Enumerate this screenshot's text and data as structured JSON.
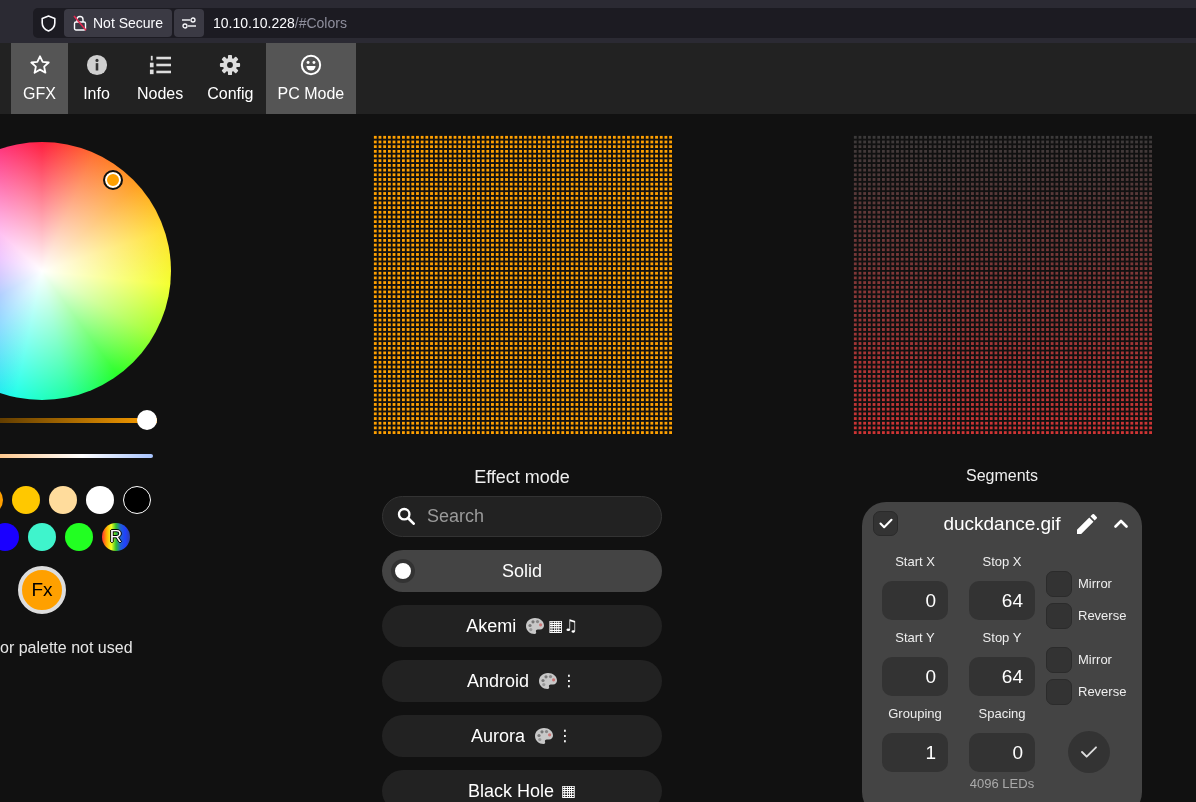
{
  "browser": {
    "security_label": "Not Secure",
    "url_host": "10.10.10.228",
    "url_path": "/#Colors"
  },
  "nav": {
    "tabs": [
      {
        "label": "GFX",
        "selected": true
      },
      {
        "label": "Info",
        "selected": false
      },
      {
        "label": "Nodes",
        "selected": false
      },
      {
        "label": "Config",
        "selected": false
      },
      {
        "label": "PC Mode",
        "selected": true
      }
    ]
  },
  "colors": {
    "brightness": {
      "level": 1
    },
    "swatch_rows": [
      [
        {
          "kind": "solid",
          "color": "#ffa000"
        },
        {
          "kind": "solid",
          "color": "#ffc800"
        },
        {
          "kind": "solid",
          "color": "#ffdc9c"
        },
        {
          "kind": "solid",
          "color": "#ffffff"
        },
        {
          "kind": "solid",
          "color": "#000000"
        }
      ],
      [
        {
          "kind": "solid",
          "color": "#1a00ff"
        },
        {
          "kind": "solid",
          "color": "#3ff4cc"
        },
        {
          "kind": "solid",
          "color": "#22ff22"
        },
        {
          "kind": "random",
          "label": "R"
        }
      ]
    ],
    "fx_button": "Fx",
    "palette_note": "or palette not used"
  },
  "effects": {
    "title": "Effect mode",
    "search": {
      "placeholder": "Search"
    },
    "items": [
      {
        "name": "Solid",
        "selected": true,
        "palette": false
      },
      {
        "name": "Akemi",
        "selected": false,
        "palette": true,
        "flags": "▦♫"
      },
      {
        "name": "Android",
        "selected": false,
        "palette": true,
        "flags": "⋮"
      },
      {
        "name": "Aurora",
        "selected": false,
        "palette": true,
        "flags": "⋮"
      },
      {
        "name": "Black Hole",
        "selected": false,
        "palette": false,
        "flags": "▦"
      }
    ]
  },
  "segments": {
    "title": "Segments",
    "segment": {
      "name": "duckdance.gif",
      "selected": true,
      "expanded": true,
      "groups": [
        {
          "kind": "options",
          "fields": [
            {
              "label": "Start X",
              "value": "0"
            },
            {
              "label": "Stop X",
              "value": "64"
            }
          ],
          "options": [
            {
              "label": "Mirror",
              "checked": false
            },
            {
              "label": "Reverse",
              "checked": false
            }
          ]
        },
        {
          "kind": "options",
          "fields": [
            {
              "label": "Start Y",
              "value": "0"
            },
            {
              "label": "Stop Y",
              "value": "64"
            }
          ],
          "options": [
            {
              "label": "Mirror",
              "checked": false
            },
            {
              "label": "Reverse",
              "checked": false
            }
          ]
        },
        {
          "kind": "apply",
          "fields": [
            {
              "label": "Grouping",
              "value": "1"
            },
            {
              "label": "Spacing",
              "value": "0"
            }
          ]
        }
      ],
      "led_count": "4096 LEDs"
    }
  }
}
